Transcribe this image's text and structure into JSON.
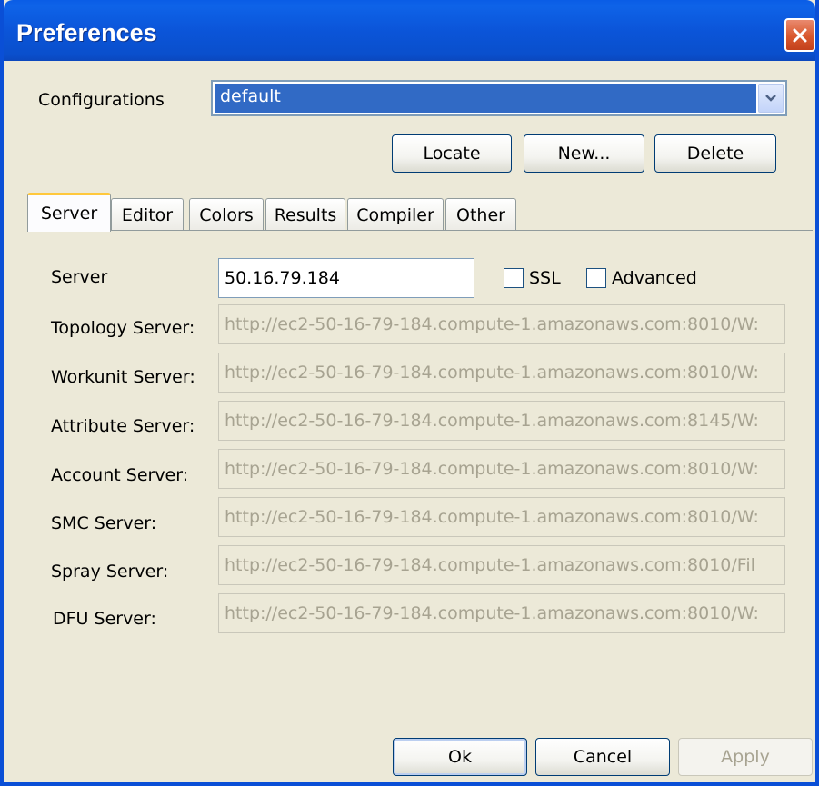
{
  "window": {
    "title": "Preferences"
  },
  "config": {
    "label": "Configurations",
    "selected": "default",
    "locate_label": "Locate",
    "new_label": "New...",
    "delete_label": "Delete"
  },
  "tabs": [
    {
      "label": "Server",
      "active": true
    },
    {
      "label": "Editor"
    },
    {
      "label": "Colors"
    },
    {
      "label": "Results"
    },
    {
      "label": "Compiler"
    },
    {
      "label": "Other"
    }
  ],
  "server": {
    "label": "Server",
    "value": "50.16.79.184",
    "ssl_label": "SSL",
    "ssl_checked": false,
    "advanced_label": "Advanced",
    "advanced_checked": false
  },
  "fields": [
    {
      "label": "Topology Server:",
      "value": "http://ec2-50-16-79-184.compute-1.amazonaws.com:8010/W:"
    },
    {
      "label": "Workunit Server:",
      "value": "http://ec2-50-16-79-184.compute-1.amazonaws.com:8010/W:"
    },
    {
      "label": "Attribute Server:",
      "value": "http://ec2-50-16-79-184.compute-1.amazonaws.com:8145/W:"
    },
    {
      "label": "Account Server:",
      "value": "http://ec2-50-16-79-184.compute-1.amazonaws.com:8010/W:"
    },
    {
      "label": "SMC Server:",
      "value": "http://ec2-50-16-79-184.compute-1.amazonaws.com:8010/W:"
    },
    {
      "label": "Spray Server:",
      "value": "http://ec2-50-16-79-184.compute-1.amazonaws.com:8010/Fil"
    },
    {
      "label": "DFU Server:",
      "value": "http://ec2-50-16-79-184.compute-1.amazonaws.com:8010/W:"
    }
  ],
  "footer": {
    "ok_label": "Ok",
    "cancel_label": "Cancel",
    "apply_label": "Apply"
  },
  "colors": {
    "titlebar": "#0a55d9",
    "selection": "#316ac5",
    "tab_active_accent": "#ffc83c",
    "dialog_bg": "#ece9d8"
  }
}
